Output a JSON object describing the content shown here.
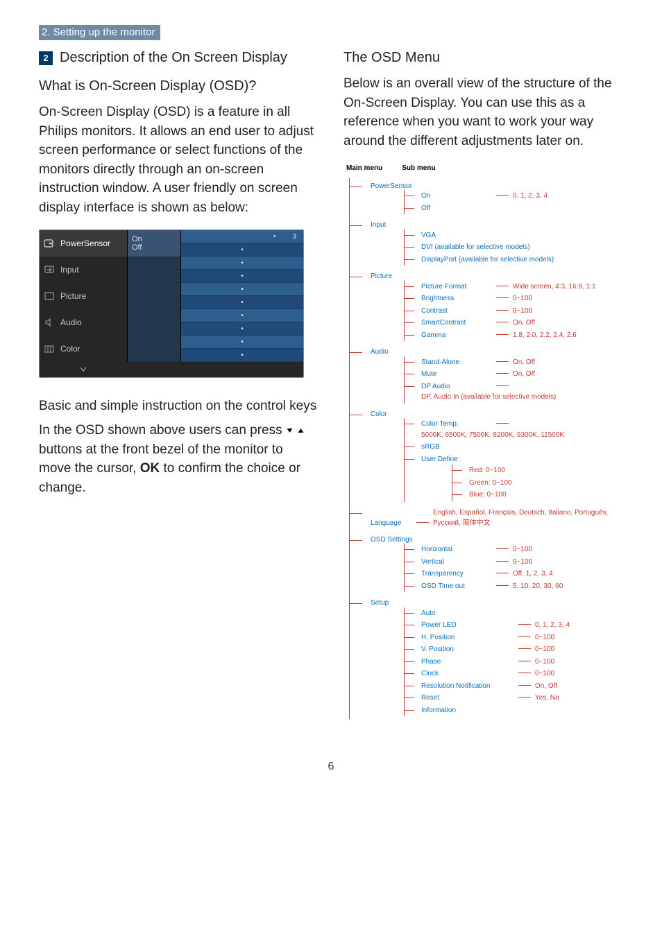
{
  "section_bar": "2. Setting up the monitor",
  "step_badge": "2",
  "step_title": "Description of the On Screen Display",
  "left": {
    "q1": "What is On-Screen Display (OSD)?",
    "p1": "On-Screen Display (OSD) is a feature in all Philips monitors. It allows an end user to adjust screen performance or select functions of the monitors directly through an on-screen instruction window. A user friendly on screen display interface is shown as below:",
    "osd": {
      "items": [
        "PowerSensor",
        "Input",
        "Picture",
        "Audio",
        "Color"
      ],
      "opt_on": "On",
      "opt_off": "Off",
      "value": "3",
      "dot": "•"
    },
    "sub": "Basic and simple instruction on the control keys",
    "p2a": "In the OSD shown above users can press ",
    "p2b": " buttons at the front bezel of the monitor to move the cursor, ",
    "ok": "OK",
    "p2c": " to confirm the choice or change."
  },
  "right": {
    "h": "The OSD Menu",
    "p": "Below is an overall view of the structure of the On-Screen Display. You can use this as a reference when you want to work your way around the different adjustments later on.",
    "hdr_main": "Main menu",
    "hdr_sub": "Sub menu",
    "menu": [
      {
        "name": "PowerSensor",
        "sub": [
          {
            "label": "On",
            "vals": "0, 1, 2, 3, 4"
          },
          {
            "label": "Off"
          }
        ]
      },
      {
        "name": "Input",
        "sub": [
          {
            "label": "VGA"
          },
          {
            "label": "DVI (available for selective models)"
          },
          {
            "label": "DisplayPort (available for selective models)"
          }
        ]
      },
      {
        "name": "Picture",
        "sub": [
          {
            "label": "Picture Format",
            "vals": "Wide screen, 4:3, 16:9, 1:1"
          },
          {
            "label": "Brightness",
            "vals": "0~100"
          },
          {
            "label": "Contrast",
            "vals": "0~100"
          },
          {
            "label": "SmartContrast",
            "vals": "On, Off"
          },
          {
            "label": "Gamma",
            "vals": "1.8, 2.0, 2.2, 2.4, 2.6"
          }
        ]
      },
      {
        "name": "Audio",
        "sub": [
          {
            "label": "Stand-Alone",
            "vals": "On, Off"
          },
          {
            "label": "Mute",
            "vals": "On, Off"
          },
          {
            "label": "DP Audio",
            "vals": "DP, Audio In (available for selective models)"
          }
        ]
      },
      {
        "name": "Color",
        "sub": [
          {
            "label": "Color Temp.",
            "vals": "5000K, 6500K, 7500K, 8200K, 9300K, 11500K"
          },
          {
            "label": "sRGB"
          },
          {
            "label": "User Define",
            "nested": [
              "Red: 0~100",
              "Green: 0~100",
              "Blue: 0~100"
            ]
          }
        ]
      },
      {
        "name": "Language",
        "lang": "English, Español, Français, Deutsch, Italiano, Português, Русский, 简体中文"
      },
      {
        "name": "OSD Settings",
        "sub": [
          {
            "label": "Horizontal",
            "vals": "0~100"
          },
          {
            "label": "Vertical",
            "vals": "0~100"
          },
          {
            "label": "Transparency",
            "vals": "Off, 1, 2, 3, 4"
          },
          {
            "label": "OSD Time out",
            "vals": "5, 10, 20, 30, 60"
          }
        ]
      },
      {
        "name": "Setup",
        "wide": true,
        "sub": [
          {
            "label": "Auto"
          },
          {
            "label": "Power LED",
            "vals": "0, 1, 2, 3, 4"
          },
          {
            "label": "H. Position",
            "vals": "0~100"
          },
          {
            "label": "V. Position",
            "vals": "0~100"
          },
          {
            "label": "Phase",
            "vals": "0~100"
          },
          {
            "label": "Clock",
            "vals": "0~100"
          },
          {
            "label": "Resolution Notification",
            "vals": "On, Off"
          },
          {
            "label": "Reset",
            "vals": "Yes, No"
          },
          {
            "label": "Information"
          }
        ]
      }
    ]
  },
  "page_number": "6"
}
